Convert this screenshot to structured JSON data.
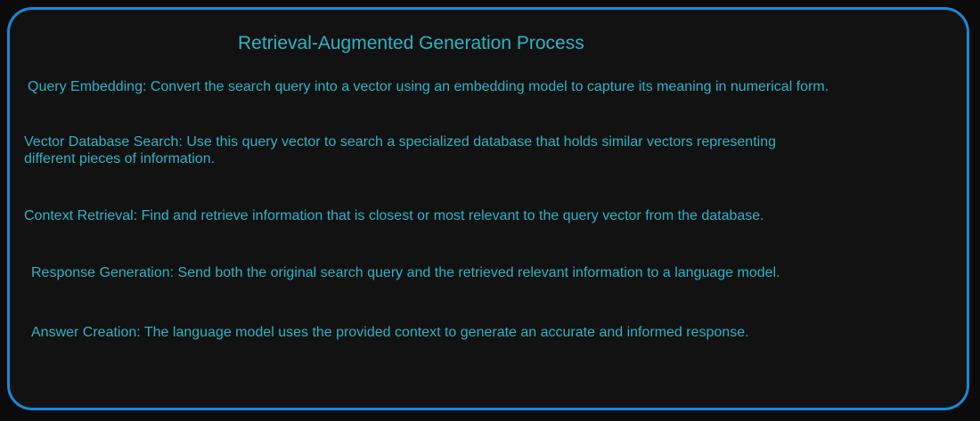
{
  "title": "Retrieval-Augmented Generation Process",
  "steps": [
    {
      "text": "Query Embedding: Convert the search query into a vector using an embedding model to capture its meaning in numerical form."
    },
    {
      "text": "Vector Database Search: Use this query vector to search a specialized database that holds similar vectors representing different pieces of information."
    },
    {
      "text": "Context Retrieval: Find and retrieve information that is closest or most relevant to the query vector from the database."
    },
    {
      "text": "Response Generation: Send both the original search query and the retrieved relevant information to a language model."
    },
    {
      "text": "Answer Creation: The language model uses the provided context to generate an accurate and informed response."
    }
  ],
  "colors": {
    "border": "#1c86d8",
    "text": "#2bb3c6",
    "panel": "#121212",
    "background": "#0b0b0b"
  }
}
